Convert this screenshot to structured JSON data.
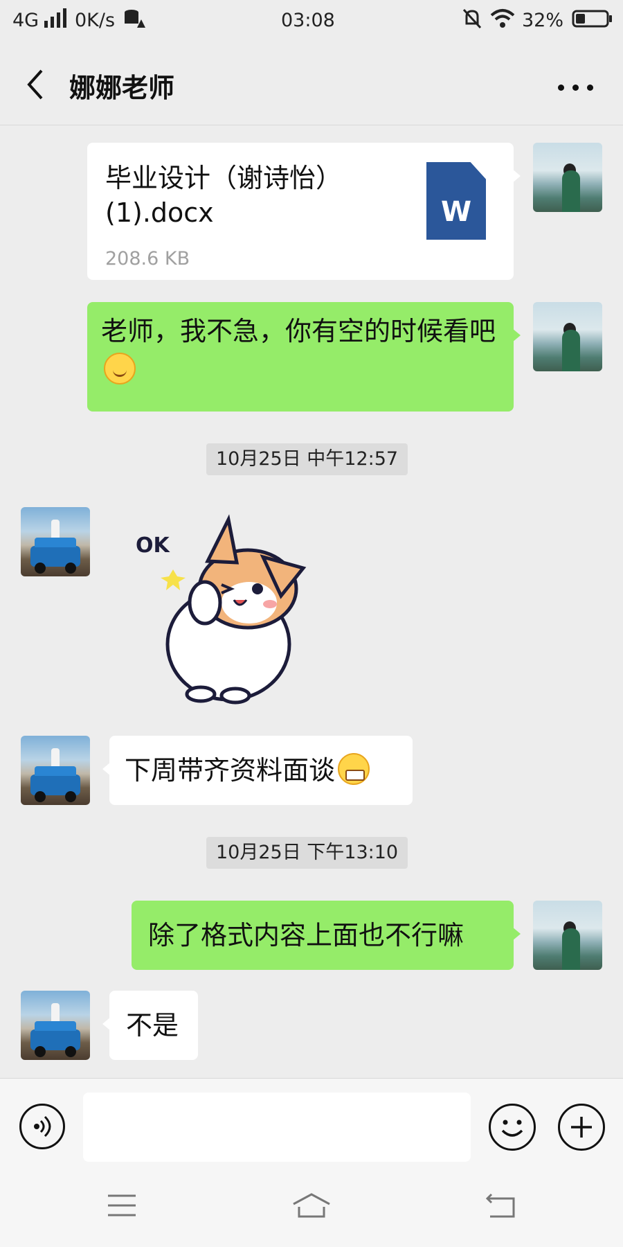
{
  "status_bar": {
    "network": "4G",
    "speed": "0K/s",
    "time": "03:08",
    "battery": "32%",
    "battery_level": 0.32
  },
  "header": {
    "title": "娜娜老师",
    "back_icon": "chevron-left-icon",
    "menu_icon": "more-dots-icon"
  },
  "messages": {
    "file": {
      "name": "毕业设计（谢诗怡）(1).docx",
      "size": "208.6 KB",
      "icon": "word-doc-icon",
      "icon_letter": "W"
    },
    "m1": "老师，我不急，你有空的时候看吧",
    "m1_emoji": "smile-emoji",
    "ts1": "10月25日 中午12:57",
    "sticker_text": "OK",
    "m2": "下周带齐资料面谈",
    "m2_emoji": "grimace-emoji",
    "ts2": "10月25日 下午13:10",
    "m3": "除了格式内容上面也不行嘛",
    "m4": "不是"
  },
  "input_bar": {
    "text_value": "",
    "voice_icon": "voice-icon",
    "emoji_icon": "emoji-icon",
    "plus_icon": "plus-icon"
  },
  "nav_bar": {
    "menu_icon": "menu-icon",
    "home_icon": "home-icon",
    "back_icon": "back-icon"
  },
  "colors": {
    "sent_bubble": "#95ec69",
    "received_bubble": "#ffffff",
    "background": "#ededed",
    "word_blue": "#2b579a"
  }
}
